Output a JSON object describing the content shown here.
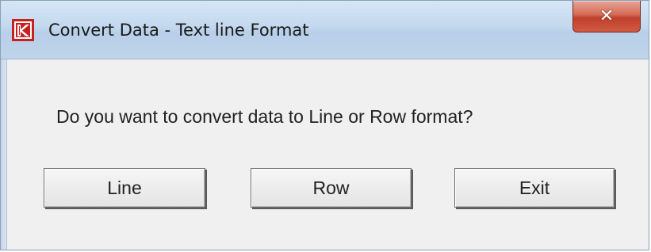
{
  "window": {
    "title": "Convert Data - Text line Format",
    "icon": "k-logo-icon",
    "close_icon": "close-icon",
    "close_glyph": "✕",
    "brand_color": "#c8201e"
  },
  "dialog": {
    "message": "Do you want to convert data to Line or Row format?",
    "buttons": {
      "line_label": "Line",
      "row_label": "Row",
      "exit_label": "Exit"
    }
  }
}
